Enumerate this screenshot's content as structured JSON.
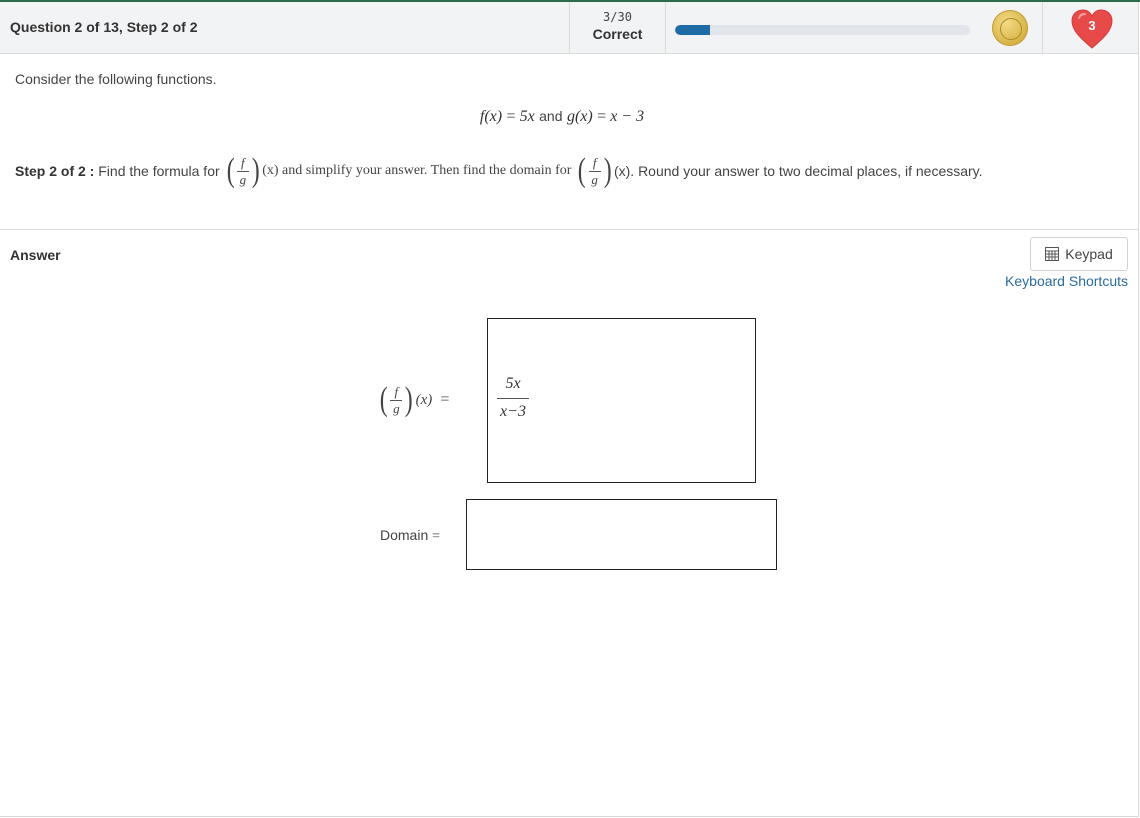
{
  "header": {
    "question_title": "Question 2 of 13, Step 2 of 2",
    "score": "3/30",
    "score_label": "Correct",
    "progress_fraction": 0.12,
    "lives": "3",
    "colors": {
      "progress_fill": "#1f6ba5",
      "heart": "#e84a4a",
      "coin": "#d6b246"
    }
  },
  "problem": {
    "intro": "Consider the following functions.",
    "functions": {
      "f_lhs": "f(x)",
      "f_rhs": "5x",
      "joiner": "and",
      "g_lhs": "g(x)",
      "g_rhs": "x − 3"
    },
    "step_label": "Step 2 of 2 :",
    "step_text_1": "Find the formula for",
    "step_text_2": "(x) and simplify your answer. Then find the domain for",
    "step_text_3": "(x). Round your answer to two decimal places, if necessary.",
    "frac_num": "f",
    "frac_den": "g"
  },
  "answer": {
    "label": "Answer",
    "keypad_label": "Keypad",
    "keypad_icon": "calculator-icon",
    "shortcuts_label": "Keyboard Shortcuts",
    "lhs_frac_num": "f",
    "lhs_frac_den": "g",
    "lhs_arg": "(x)",
    "equals": "=",
    "formula_value": {
      "numerator": "5x",
      "denominator": "x−3"
    },
    "domain_label": "Domain",
    "domain_equals": "=",
    "domain_value": ""
  }
}
